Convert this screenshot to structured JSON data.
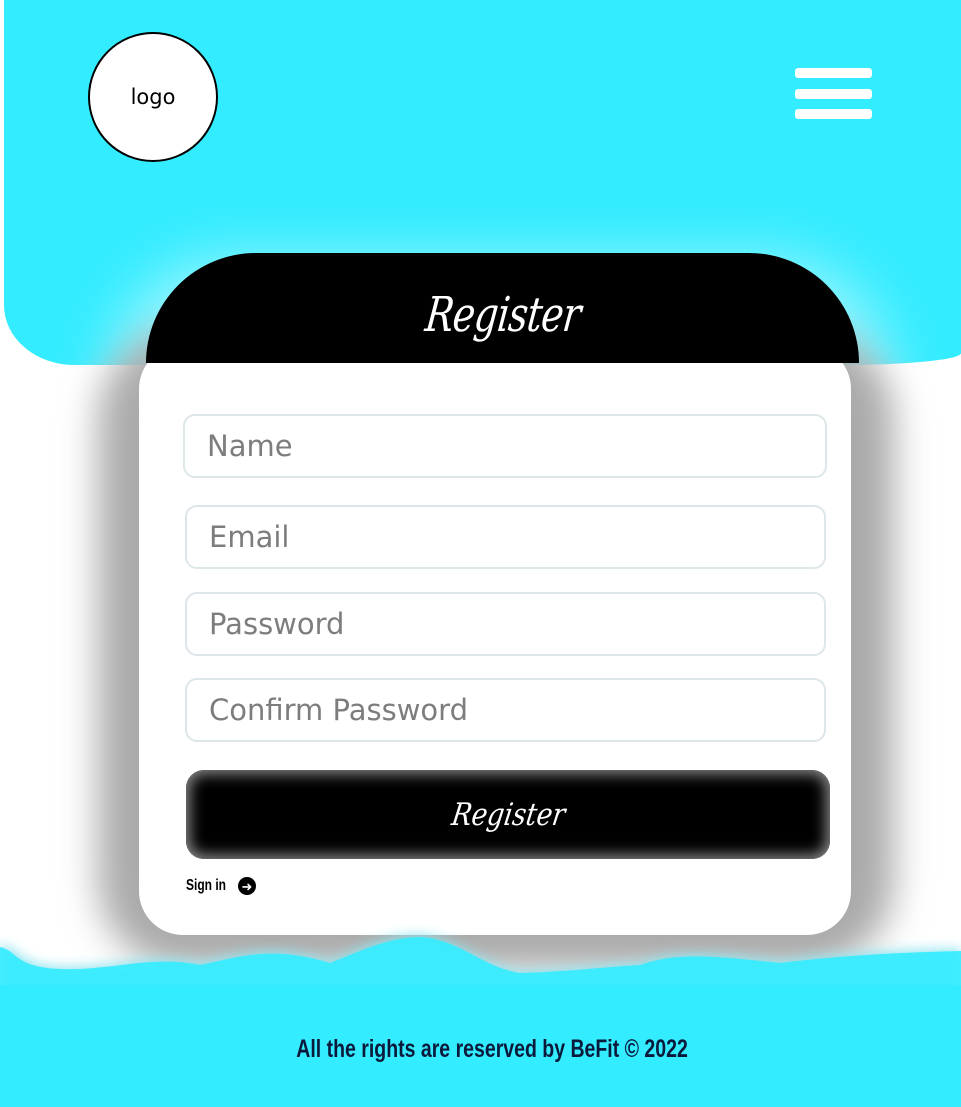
{
  "header": {
    "logo_text": "logo",
    "menu_icon": "hamburger-menu-icon"
  },
  "form": {
    "title": "Register",
    "fields": {
      "name": {
        "placeholder": "Name",
        "value": ""
      },
      "email": {
        "placeholder": "Email",
        "value": ""
      },
      "password": {
        "placeholder": "Password",
        "value": ""
      },
      "confirm_password": {
        "placeholder": "Confirm Password",
        "value": ""
      }
    },
    "submit_label": "Register",
    "signin_label": "Sign in",
    "signin_icon": "arrow-right-circle-icon"
  },
  "footer": {
    "text": "All the rights are reserved by BeFit © 2022"
  },
  "colors": {
    "brand_cyan": "#33ecff",
    "card_header": "#000000",
    "footer_text": "#0b1a3a"
  }
}
